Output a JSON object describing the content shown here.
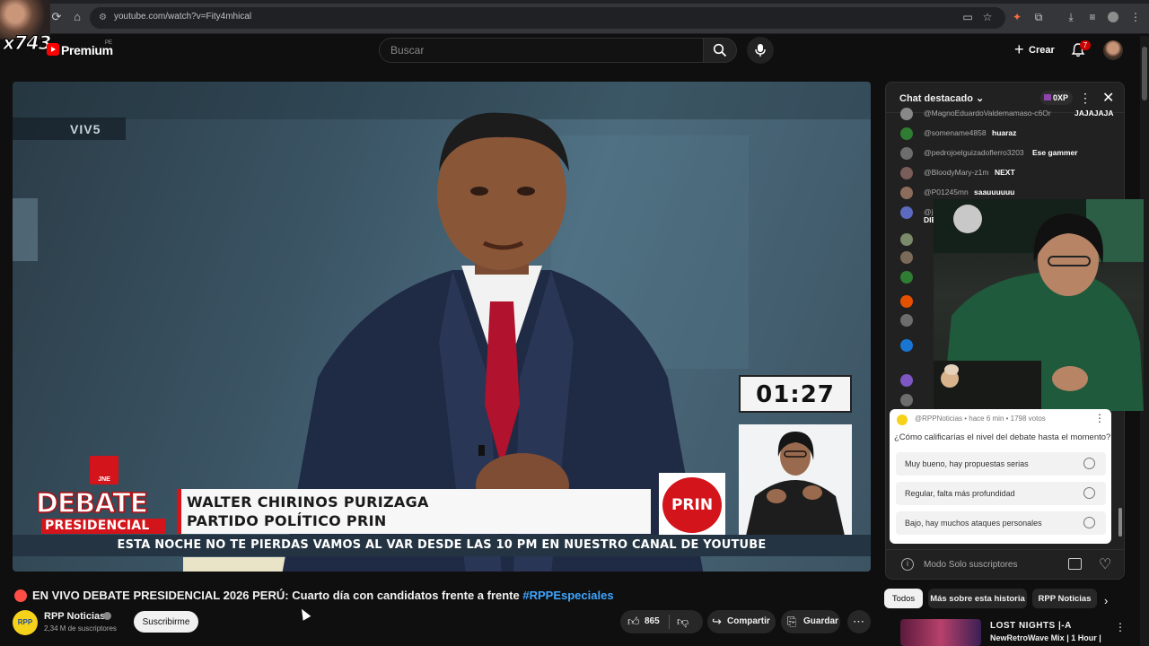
{
  "browser": {
    "url": "youtube.com/watch?v=Fity4mhical"
  },
  "overlay": {
    "streamer_tag": "x743"
  },
  "header": {
    "premium_label": "Premium",
    "region": "PE",
    "search_placeholder": "Buscar",
    "create_label": "Crear",
    "notification_count": "7"
  },
  "video": {
    "live_tag": "VIV5",
    "timer": "01:27",
    "jne_label": "JNE",
    "debate_word": "DEBATE",
    "presidencial_word": "PRESIDENCIAL",
    "name_line1": "WALTER CHIRINOS PURIZAGA",
    "name_line2": "PARTIDO POLÍTICO PRIN",
    "party_logo": "PRIN",
    "ticker": "ESTA NOCHE NO TE PIERDAS VAMOS AL VAR DESDE LAS 10 PM EN NUESTRO CANAL DE YOUTUBE"
  },
  "below_video": {
    "title": "EN VIVO DEBATE PRESIDENCIAL 2026 PERÚ: Cuarto día con candidatos frente a frente",
    "hashtag": "#RPPEspeciales",
    "channel_initials": "RPP",
    "channel_name": "RPP Noticias",
    "subscribers": "2,34 M de suscriptores",
    "subscribe_label": "Suscribirme",
    "likes": "865",
    "share_label": "Compartir",
    "save_label": "Guardar"
  },
  "chat": {
    "title": "Chat destacado",
    "xp_label": "0XP",
    "messages": [
      {
        "author": "@MagnoEduardoValdemamaso-c6Or",
        "text": "JAJAJAJA",
        "color": "#888888"
      },
      {
        "author": "@somename4858",
        "text": "huaraz",
        "color": "#2e7d32"
      },
      {
        "author": "@pedrojoelguizadoflerro3203",
        "text": "Ese gammer",
        "color": "#6d6d6d"
      },
      {
        "author": "@BloodyMary-z1m",
        "text": "NEXT",
        "color": "#7a5c58"
      },
      {
        "author": "@P01245mn",
        "text": "saauuuuuu",
        "color": "#8c6d5b"
      },
      {
        "author": "@joel",
        "text": "DIBI",
        "color": "#5c6bc0"
      }
    ],
    "footer_label": "Modo Solo suscriptores"
  },
  "poll": {
    "meta": "@RPPNoticias • hace 6 min • 1798 votos",
    "question": "¿Cómo calificarías el nivel del debate hasta el momento?",
    "options": [
      "Muy bueno, hay propuestas serias",
      "Regular, falta más profundidad",
      "Bajo, hay muchos ataques personales"
    ]
  },
  "chips": [
    "Todos",
    "Más sobre esta historia",
    "RPP Noticias"
  ],
  "recommendation": {
    "title": "LOST NIGHTS |-A",
    "subtitle": "NewRetroWave Mix | 1 Hour |"
  },
  "colors": {
    "accent_red": "#d3141b",
    "link_blue": "#3ea6ff",
    "ticker_bg": "#243442"
  }
}
